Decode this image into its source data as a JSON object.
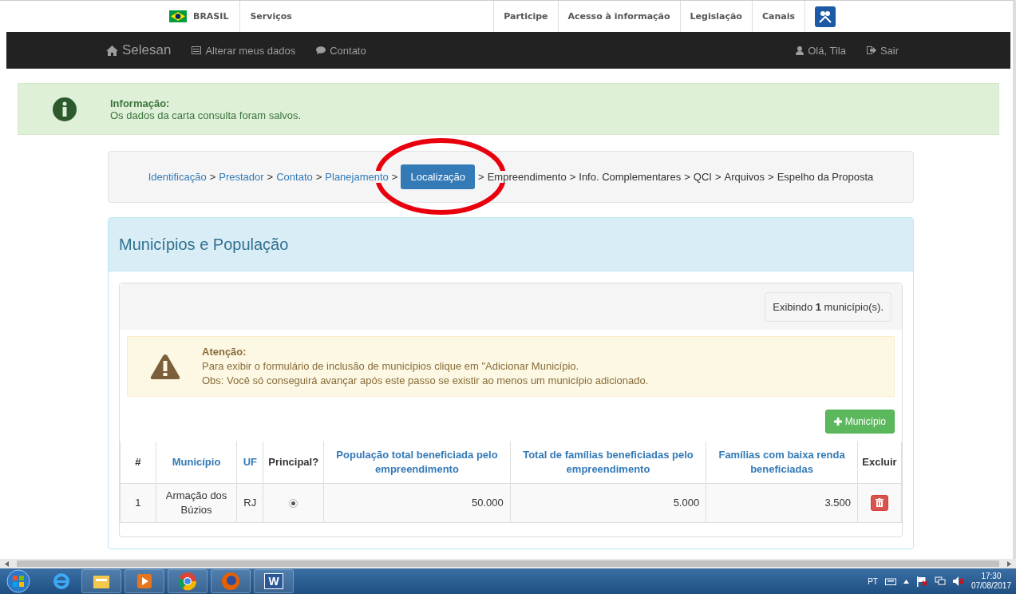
{
  "gov_bar": {
    "country": "BRASIL",
    "left_links": [
      "Serviços"
    ],
    "right_links": [
      "Participe",
      "Acesso à informação",
      "Legislação",
      "Canais"
    ]
  },
  "navbar": {
    "brand": "Selesan",
    "items": [
      {
        "kind": "card",
        "label": "Alterar meus dados"
      },
      {
        "kind": "chat",
        "label": "Contato"
      }
    ],
    "user": "Olá, Tila",
    "logout": "Sair"
  },
  "alert": {
    "title": "Informação:",
    "message": "Os dados da carta consulta foram salvos."
  },
  "steps": [
    {
      "label": "Identificação",
      "kind": "done",
      "separator": ">"
    },
    {
      "label": "Prestador",
      "kind": "done",
      "separator": ">"
    },
    {
      "label": "Contato",
      "kind": "done",
      "separator": ">"
    },
    {
      "label": "Planejamento",
      "kind": "done",
      "separator": ">"
    },
    {
      "label": "Localização",
      "kind": "current",
      "separator": ">"
    },
    {
      "label": "Empreendimento",
      "kind": "pending",
      "separator": ">"
    },
    {
      "label": "Info. Complementares",
      "kind": "pending",
      "separator": ">"
    },
    {
      "label": "QCI",
      "kind": "pending",
      "separator": ">"
    },
    {
      "label": "Arquivos",
      "kind": "pending",
      "separator": ">"
    },
    {
      "label": "Espelho da Proposta",
      "kind": "pending"
    }
  ],
  "panel": {
    "title": "Municípios e População",
    "count": "Exibindo **1** município(s).",
    "warning": {
      "title": "Atenção:",
      "lines": [
        "Para exibir o formulário de inclusão de municípios clique em \"Adicionar Município.",
        "Obs: Você só conseguirá avançar após este passo se existir ao menos um município adicionado."
      ]
    },
    "add_button": "Município",
    "table": {
      "columns": [
        {
          "label": "#",
          "kind": "plain"
        },
        {
          "label": "Município",
          "kind": "link"
        },
        {
          "label": "UF",
          "kind": "link"
        },
        {
          "label": "Principal?",
          "kind": "plain"
        },
        {
          "label": "População total beneficiada pelo empreendimento",
          "kind": "link"
        },
        {
          "label": "Total de famílias beneficiadas pelo empreendimento",
          "kind": "link"
        },
        {
          "label": "Famílias com baixa renda beneficiadas",
          "kind": "link"
        },
        {
          "label": "Excluir",
          "kind": "plain"
        }
      ],
      "rows": [
        {
          "number": "1",
          "municipio": "Armação dos Búzios",
          "uf": "RJ",
          "principal": true,
          "populacao": "50.000",
          "familias": "5.000",
          "baixa_renda": "3.500"
        }
      ]
    }
  },
  "taskbar": {
    "apps": [
      {
        "kind": "ie"
      },
      {
        "kind": "explorer"
      },
      {
        "kind": "media"
      },
      {
        "kind": "chrome"
      },
      {
        "kind": "firefox"
      },
      {
        "kind": "word",
        "label": "W"
      }
    ],
    "language": "PT",
    "time": "17:30",
    "date": "07/08/2017"
  }
}
